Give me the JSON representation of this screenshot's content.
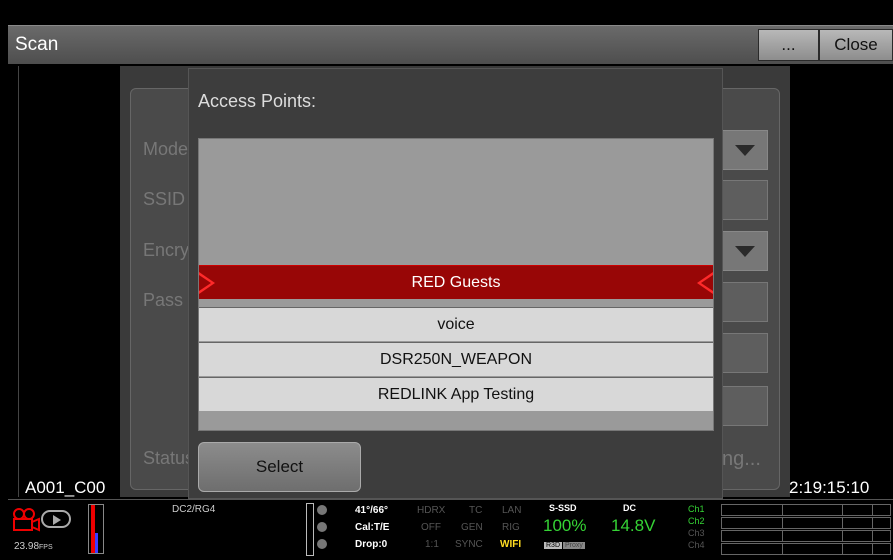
{
  "scan_bar": {
    "title": "Scan",
    "more_label": "...",
    "close_label": "Close"
  },
  "wifi_background": {
    "labels": [
      "Mode",
      "SSID",
      "Encryption",
      "Pass"
    ],
    "status_label": "Status",
    "status_value": "ng..."
  },
  "dialog": {
    "title": "Access Points:",
    "access_points": [
      "RED Guests",
      "voice",
      "DSR250N_WEAPON",
      "REDLINK App Testing"
    ],
    "selected": "RED Guests",
    "select_label": "Select"
  },
  "overlay": {
    "clip_name": "A001_C00",
    "timecode": "2:19:15:10"
  },
  "status_bar": {
    "fps": "23.98",
    "fps_unit": "FPS",
    "color_science": "DC2/RG4",
    "temp": "41°/66°",
    "cal_label": "Cal:",
    "cal_value": "T/E",
    "drop_label": "Drop:",
    "drop_value": "0",
    "hdrx": "HDRX",
    "hdrx_value": "OFF",
    "ratio": "1:1",
    "tc": "TC",
    "gen": "GEN",
    "sync": "SYNC",
    "lan": "LAN",
    "rig": "RIG",
    "wifi": "WIFI",
    "media_label": "S-SSD",
    "media_percent": "100%",
    "r3d": "R3D",
    "proxy": "Proxy",
    "power_label": "DC",
    "voltage": "14.8V",
    "channels": [
      "Ch1",
      "Ch2",
      "Ch3",
      "Ch4"
    ]
  },
  "colors": {
    "selected_row": "#980606",
    "selected_arrow": "#ff2a2a",
    "ok_green": "#35d335",
    "wifi_yellow": "#ffdd22"
  }
}
